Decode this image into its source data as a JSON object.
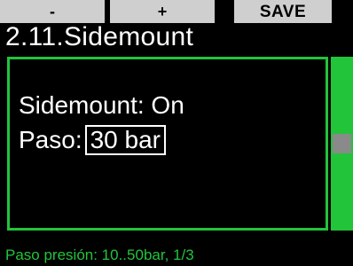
{
  "softkeys": {
    "minus_label": "-",
    "plus_label": "+",
    "save_label": "SAVE"
  },
  "header": {
    "title": "2.11.Sidemount"
  },
  "settings": {
    "sidemount_label": "Sidemount:",
    "sidemount_value": "On",
    "paso_label": "Paso:",
    "paso_value": "30 bar"
  },
  "scroll": {
    "position_fraction": 0.5
  },
  "status": {
    "text": "Paso presión: 10..50bar, 1/3"
  },
  "colors": {
    "accent": "#22c43a",
    "softkey_bg": "#cfcfcf",
    "background": "#000000",
    "scroll_thumb": "#8a8a8a"
  }
}
